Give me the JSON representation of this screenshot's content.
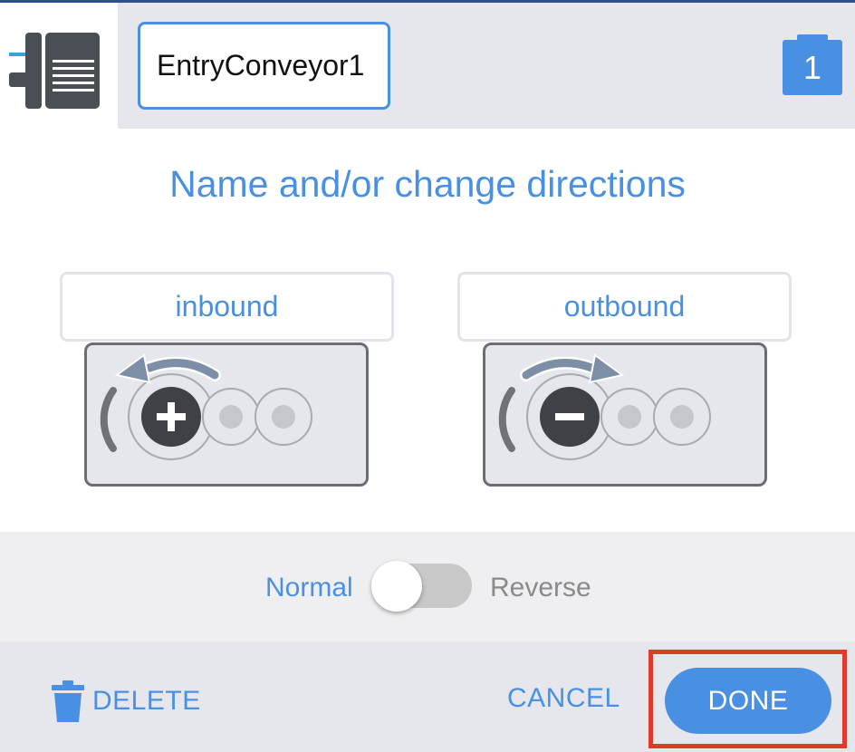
{
  "header": {
    "name_value": "EntryConveyor1",
    "badge_count": "1"
  },
  "dialog": {
    "title": "Name and/or change directions"
  },
  "directions": {
    "inbound_label": "inbound",
    "outbound_label": "outbound"
  },
  "toggle": {
    "normal_label": "Normal",
    "reverse_label": "Reverse",
    "state": "Normal"
  },
  "footer": {
    "delete_label": "DELETE",
    "cancel_label": "CANCEL",
    "done_label": "DONE"
  },
  "colors": {
    "accent": "#4a90e2",
    "header_bg": "#e6e7ec",
    "highlight": "#e03a2c"
  },
  "icons": {
    "device": "conveyor-device-icon",
    "badge": "clipboard-badge-icon",
    "inbound": "rotate-counterclockwise-icon",
    "outbound": "rotate-clockwise-icon",
    "plus": "plus-icon",
    "minus": "minus-icon",
    "trash": "trash-icon"
  }
}
